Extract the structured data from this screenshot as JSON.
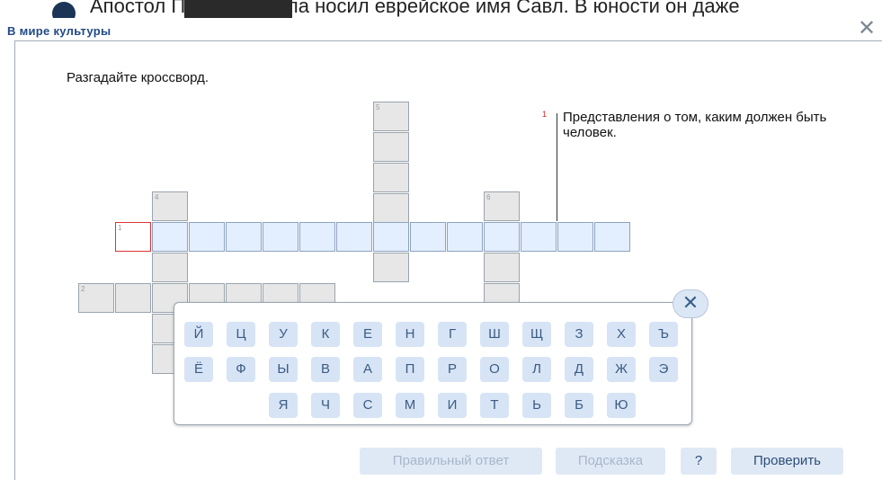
{
  "background": {
    "text": "Апостол Павел сначала носил еврейское имя Савл. В юности он даже"
  },
  "dialog": {
    "title": "В мире культуры",
    "close_icon": "close-icon"
  },
  "task": {
    "heading": "Разгадайте кроссворд.",
    "clue_number": "1",
    "clue_text": "Представления о том, каким должен быть человек."
  },
  "crossword": {
    "numbers": {
      "n1": "1",
      "n2": "2",
      "n4": "4",
      "n5": "5",
      "n6": "6"
    }
  },
  "keyboard": {
    "row1": [
      "Й",
      "Ц",
      "У",
      "К",
      "Е",
      "Н",
      "Г",
      "Ш",
      "Щ",
      "З",
      "Х",
      "Ъ"
    ],
    "row2": [
      "Ё",
      "Ф",
      "Ы",
      "В",
      "А",
      "П",
      "Р",
      "О",
      "Л",
      "Д",
      "Ж",
      "Э"
    ],
    "row3": [
      "Я",
      "Ч",
      "С",
      "М",
      "И",
      "Т",
      "Ь",
      "Б",
      "Ю"
    ],
    "close_label": "✕"
  },
  "buttons": {
    "answer": "Правильный ответ",
    "hint": "Подсказка",
    "help": "?",
    "check": "Проверить"
  }
}
